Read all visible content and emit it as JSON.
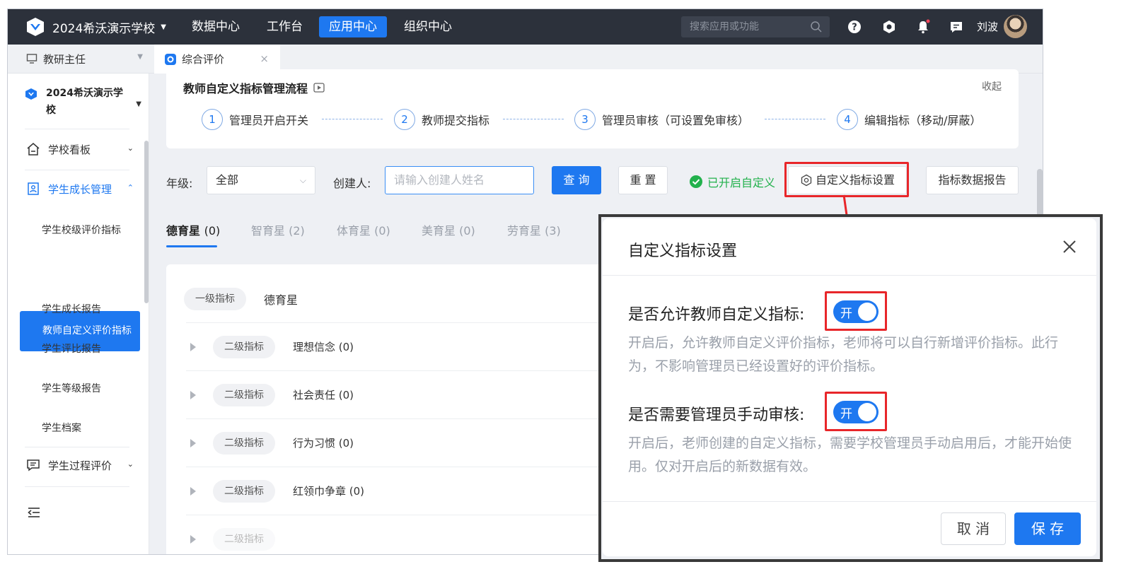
{
  "topbar": {
    "school": "2024希沃演示学校",
    "nav": [
      "数据中心",
      "工作台",
      "应用中心",
      "组织中心"
    ],
    "search_placeholder": "搜索应用或功能",
    "user": "刘波"
  },
  "tabbar": {
    "role": "教研主任",
    "tab": "综合评价"
  },
  "sidebar": {
    "school": "2024希沃演示学校",
    "items": [
      {
        "label": "学校看板"
      },
      {
        "label": "学生成长管理"
      },
      {
        "label": "学生过程评价"
      }
    ],
    "sub": [
      "学生校级评价指标",
      "教师自定义评价指标",
      "学生成长报告",
      "学生评比报告",
      "学生等级报告",
      "学生档案"
    ]
  },
  "flow": {
    "title": "教师自定义指标管理流程",
    "collapse": "收起",
    "steps": [
      {
        "num": "1",
        "label": "管理员开启开关"
      },
      {
        "num": "2",
        "label": "教师提交指标"
      },
      {
        "num": "3",
        "label": "管理员审核（可设置免审核）"
      },
      {
        "num": "4",
        "label": "编辑指标（移动/屏蔽）"
      }
    ]
  },
  "filters": {
    "grade_label": "年级:",
    "grade_value": "全部",
    "creator_label": "创建人:",
    "creator_placeholder": "请输入创建人姓名",
    "query": "查 询",
    "reset": "重 置",
    "status": "已开启自定义",
    "settings": "自定义指标设置",
    "report": "指标数据报告"
  },
  "tabs": [
    {
      "name": "德育星",
      "count": "(0)"
    },
    {
      "name": "智育星",
      "count": "(2)"
    },
    {
      "name": "体育星",
      "count": "(0)"
    },
    {
      "name": "美育星",
      "count": "(0)"
    },
    {
      "name": "劳育星",
      "count": "(3)"
    }
  ],
  "list": {
    "level1_tag": "一级指标",
    "level1_name": "德育星",
    "level2_tag": "二级指标",
    "rows": [
      "理想信念 (0)",
      "社会责任 (0)",
      "行为习惯 (0)",
      "红领巾争章 (0)"
    ]
  },
  "modal": {
    "title": "自定义指标设置",
    "setting1_label": "是否允许教师自定义指标:",
    "setting1_toggle": "开",
    "setting1_desc": "开启后，允许教师自定义评价指标，老师将可以自行新增评价指标。此行为，不影响管理员已经设置好的评价指标。",
    "setting2_label": "是否需要管理员手动审核:",
    "setting2_toggle": "开",
    "setting2_desc": "开启后，老师创建的自定义指标，需要学校管理员手动启用后，才能开始使用。仅对开启后的新数据有效。",
    "cancel": "取 消",
    "save": "保 存"
  },
  "colors": {
    "primary": "#1e78f0",
    "topbar": "#2c313b",
    "highlight": "#e8262a",
    "success": "#22b14c"
  }
}
